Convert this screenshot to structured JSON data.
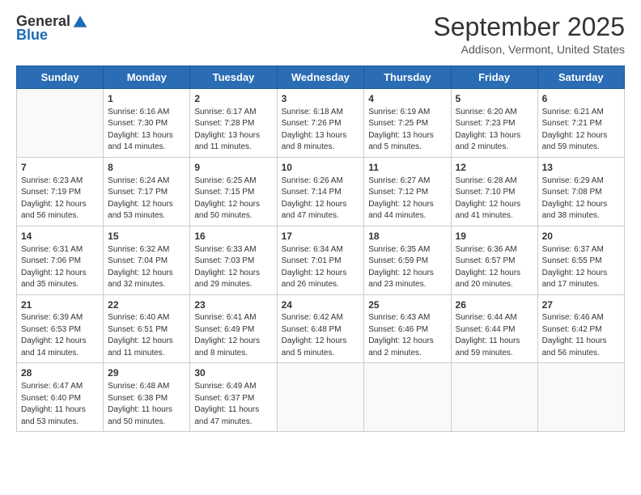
{
  "header": {
    "logo_general": "General",
    "logo_blue": "Blue",
    "title": "September 2025",
    "location": "Addison, Vermont, United States"
  },
  "days_of_week": [
    "Sunday",
    "Monday",
    "Tuesday",
    "Wednesday",
    "Thursday",
    "Friday",
    "Saturday"
  ],
  "weeks": [
    [
      {
        "day": "",
        "info": ""
      },
      {
        "day": "1",
        "info": "Sunrise: 6:16 AM\nSunset: 7:30 PM\nDaylight: 13 hours\nand 14 minutes."
      },
      {
        "day": "2",
        "info": "Sunrise: 6:17 AM\nSunset: 7:28 PM\nDaylight: 13 hours\nand 11 minutes."
      },
      {
        "day": "3",
        "info": "Sunrise: 6:18 AM\nSunset: 7:26 PM\nDaylight: 13 hours\nand 8 minutes."
      },
      {
        "day": "4",
        "info": "Sunrise: 6:19 AM\nSunset: 7:25 PM\nDaylight: 13 hours\nand 5 minutes."
      },
      {
        "day": "5",
        "info": "Sunrise: 6:20 AM\nSunset: 7:23 PM\nDaylight: 13 hours\nand 2 minutes."
      },
      {
        "day": "6",
        "info": "Sunrise: 6:21 AM\nSunset: 7:21 PM\nDaylight: 12 hours\nand 59 minutes."
      }
    ],
    [
      {
        "day": "7",
        "info": "Sunrise: 6:23 AM\nSunset: 7:19 PM\nDaylight: 12 hours\nand 56 minutes."
      },
      {
        "day": "8",
        "info": "Sunrise: 6:24 AM\nSunset: 7:17 PM\nDaylight: 12 hours\nand 53 minutes."
      },
      {
        "day": "9",
        "info": "Sunrise: 6:25 AM\nSunset: 7:15 PM\nDaylight: 12 hours\nand 50 minutes."
      },
      {
        "day": "10",
        "info": "Sunrise: 6:26 AM\nSunset: 7:14 PM\nDaylight: 12 hours\nand 47 minutes."
      },
      {
        "day": "11",
        "info": "Sunrise: 6:27 AM\nSunset: 7:12 PM\nDaylight: 12 hours\nand 44 minutes."
      },
      {
        "day": "12",
        "info": "Sunrise: 6:28 AM\nSunset: 7:10 PM\nDaylight: 12 hours\nand 41 minutes."
      },
      {
        "day": "13",
        "info": "Sunrise: 6:29 AM\nSunset: 7:08 PM\nDaylight: 12 hours\nand 38 minutes."
      }
    ],
    [
      {
        "day": "14",
        "info": "Sunrise: 6:31 AM\nSunset: 7:06 PM\nDaylight: 12 hours\nand 35 minutes."
      },
      {
        "day": "15",
        "info": "Sunrise: 6:32 AM\nSunset: 7:04 PM\nDaylight: 12 hours\nand 32 minutes."
      },
      {
        "day": "16",
        "info": "Sunrise: 6:33 AM\nSunset: 7:03 PM\nDaylight: 12 hours\nand 29 minutes."
      },
      {
        "day": "17",
        "info": "Sunrise: 6:34 AM\nSunset: 7:01 PM\nDaylight: 12 hours\nand 26 minutes."
      },
      {
        "day": "18",
        "info": "Sunrise: 6:35 AM\nSunset: 6:59 PM\nDaylight: 12 hours\nand 23 minutes."
      },
      {
        "day": "19",
        "info": "Sunrise: 6:36 AM\nSunset: 6:57 PM\nDaylight: 12 hours\nand 20 minutes."
      },
      {
        "day": "20",
        "info": "Sunrise: 6:37 AM\nSunset: 6:55 PM\nDaylight: 12 hours\nand 17 minutes."
      }
    ],
    [
      {
        "day": "21",
        "info": "Sunrise: 6:39 AM\nSunset: 6:53 PM\nDaylight: 12 hours\nand 14 minutes."
      },
      {
        "day": "22",
        "info": "Sunrise: 6:40 AM\nSunset: 6:51 PM\nDaylight: 12 hours\nand 11 minutes."
      },
      {
        "day": "23",
        "info": "Sunrise: 6:41 AM\nSunset: 6:49 PM\nDaylight: 12 hours\nand 8 minutes."
      },
      {
        "day": "24",
        "info": "Sunrise: 6:42 AM\nSunset: 6:48 PM\nDaylight: 12 hours\nand 5 minutes."
      },
      {
        "day": "25",
        "info": "Sunrise: 6:43 AM\nSunset: 6:46 PM\nDaylight: 12 hours\nand 2 minutes."
      },
      {
        "day": "26",
        "info": "Sunrise: 6:44 AM\nSunset: 6:44 PM\nDaylight: 11 hours\nand 59 minutes."
      },
      {
        "day": "27",
        "info": "Sunrise: 6:46 AM\nSunset: 6:42 PM\nDaylight: 11 hours\nand 56 minutes."
      }
    ],
    [
      {
        "day": "28",
        "info": "Sunrise: 6:47 AM\nSunset: 6:40 PM\nDaylight: 11 hours\nand 53 minutes."
      },
      {
        "day": "29",
        "info": "Sunrise: 6:48 AM\nSunset: 6:38 PM\nDaylight: 11 hours\nand 50 minutes."
      },
      {
        "day": "30",
        "info": "Sunrise: 6:49 AM\nSunset: 6:37 PM\nDaylight: 11 hours\nand 47 minutes."
      },
      {
        "day": "",
        "info": ""
      },
      {
        "day": "",
        "info": ""
      },
      {
        "day": "",
        "info": ""
      },
      {
        "day": "",
        "info": ""
      }
    ]
  ]
}
